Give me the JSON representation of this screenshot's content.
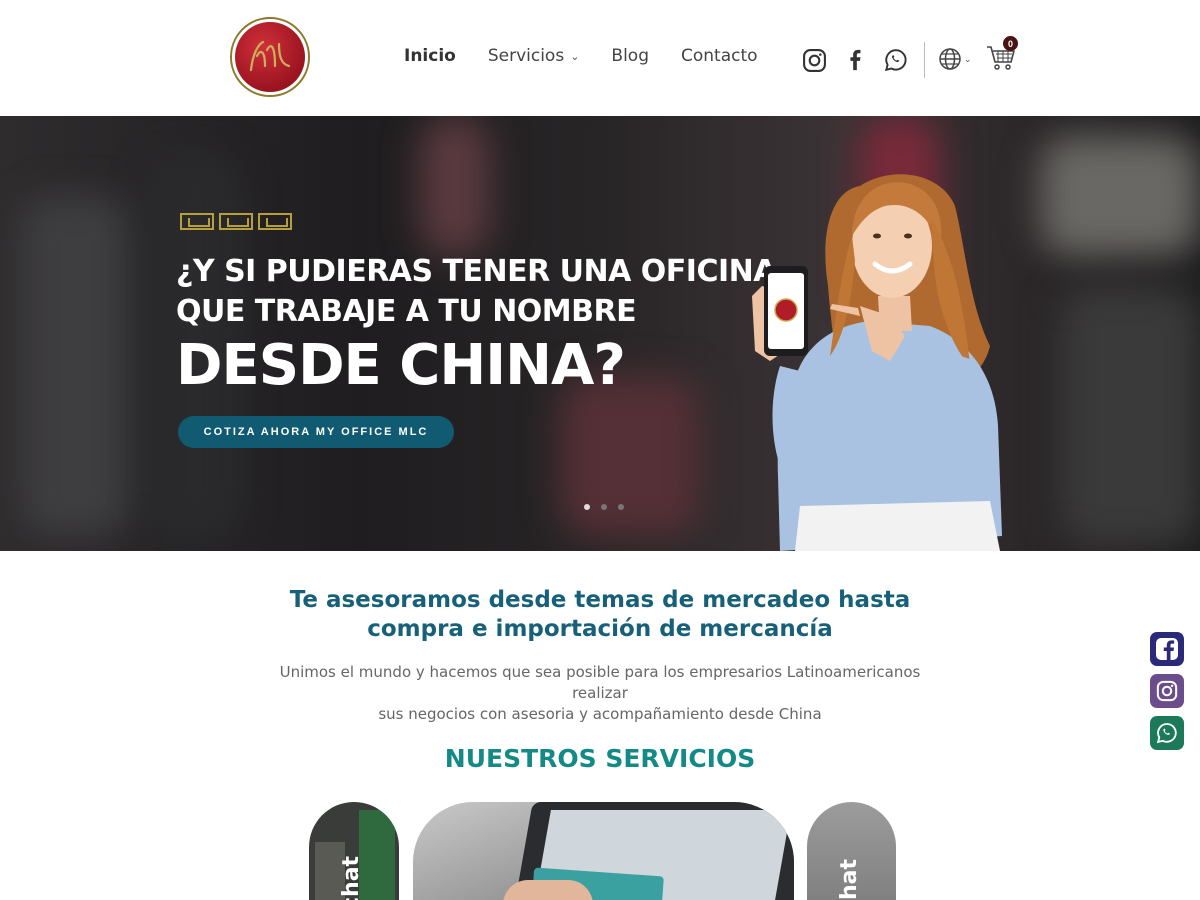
{
  "header": {
    "logo_text": "MLC",
    "nav": [
      {
        "label": "Inicio"
      },
      {
        "label": "Servicios"
      },
      {
        "label": "Blog"
      },
      {
        "label": "Contacto"
      }
    ],
    "cart_count": "0"
  },
  "hero": {
    "headline_line1": "¿Y SI PUDIERAS TENER UNA OFICINA",
    "headline_line2": "QUE TRABAJE A TU NOMBRE",
    "headline_big": "DESDE CHINA?",
    "cta_label": "COTIZA AHORA MY OFFICE MLC",
    "slides": 3,
    "active_slide": 1
  },
  "intro": {
    "title_line1": "Te asesoramos desde temas de mercadeo hasta",
    "title_line2": "compra e importación de mercancía",
    "text_line1": "Unimos el mundo y hacemos que sea posible para los empresarios Latinoamericanos realizar",
    "text_line2": "sus negocios con asesoria y acompañamiento desde China"
  },
  "services": {
    "title": "NUESTROS SERVICIOS",
    "cards": [
      {
        "label": "chat"
      },
      {
        "label": ""
      },
      {
        "label": "hat"
      }
    ]
  },
  "colors": {
    "brand_blue": "#105a72",
    "title_teal": "#17607a",
    "services_teal": "#138a86",
    "logo_red": "#b01c28",
    "gold": "#b7a03a",
    "facebook": "#2b2a7a",
    "instagram": "#6b4c8c",
    "whatsapp": "#1c7a5a"
  },
  "icons": [
    "instagram-icon",
    "facebook-icon",
    "whatsapp-icon",
    "globe-icon",
    "cart-icon"
  ]
}
